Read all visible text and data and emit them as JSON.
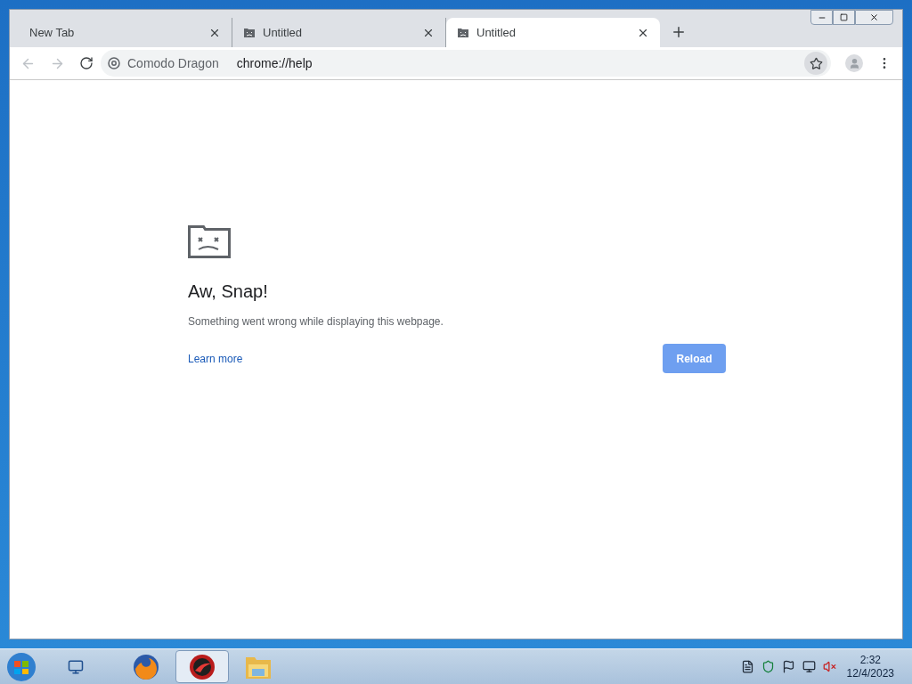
{
  "tabs": [
    {
      "title": "New Tab",
      "selected": false,
      "kind": "plain"
    },
    {
      "title": "Untitled",
      "selected": false,
      "kind": "crashed"
    },
    {
      "title": "Untitled",
      "selected": true,
      "kind": "crashed"
    }
  ],
  "toolbar": {
    "site_label": "Comodo Dragon",
    "url": "chrome://help",
    "bookmarked": false
  },
  "error_page": {
    "heading": "Aw, Snap!",
    "message": "Something went wrong while displaying this webpage.",
    "link": "Learn more",
    "button": "Reload"
  },
  "taskbar": {
    "apps": [
      {
        "kind": "firefox",
        "selected": false
      },
      {
        "kind": "dragon",
        "selected": true
      },
      {
        "kind": "explorer",
        "selected": false
      }
    ],
    "time": "2:32",
    "date": "12/4/2023"
  }
}
